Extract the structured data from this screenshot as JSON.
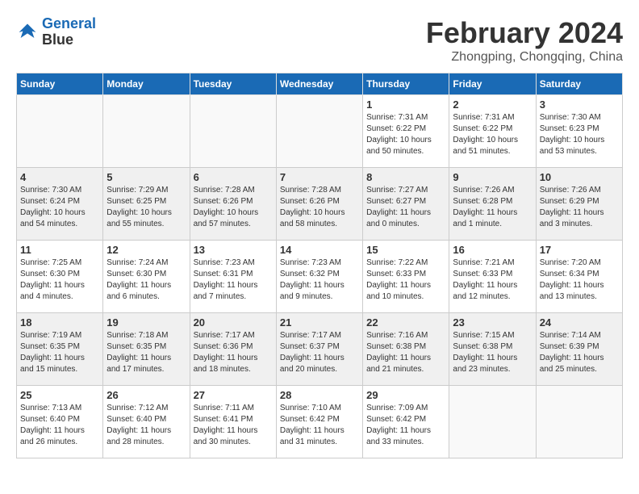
{
  "header": {
    "logo_line1": "General",
    "logo_line2": "Blue",
    "month_year": "February 2024",
    "location": "Zhongping, Chongqing, China"
  },
  "days_of_week": [
    "Sunday",
    "Monday",
    "Tuesday",
    "Wednesday",
    "Thursday",
    "Friday",
    "Saturday"
  ],
  "weeks": [
    {
      "shaded": false,
      "days": [
        {
          "num": "",
          "info": ""
        },
        {
          "num": "",
          "info": ""
        },
        {
          "num": "",
          "info": ""
        },
        {
          "num": "",
          "info": ""
        },
        {
          "num": "1",
          "info": "Sunrise: 7:31 AM\nSunset: 6:22 PM\nDaylight: 10 hours\nand 50 minutes."
        },
        {
          "num": "2",
          "info": "Sunrise: 7:31 AM\nSunset: 6:22 PM\nDaylight: 10 hours\nand 51 minutes."
        },
        {
          "num": "3",
          "info": "Sunrise: 7:30 AM\nSunset: 6:23 PM\nDaylight: 10 hours\nand 53 minutes."
        }
      ]
    },
    {
      "shaded": true,
      "days": [
        {
          "num": "4",
          "info": "Sunrise: 7:30 AM\nSunset: 6:24 PM\nDaylight: 10 hours\nand 54 minutes."
        },
        {
          "num": "5",
          "info": "Sunrise: 7:29 AM\nSunset: 6:25 PM\nDaylight: 10 hours\nand 55 minutes."
        },
        {
          "num": "6",
          "info": "Sunrise: 7:28 AM\nSunset: 6:26 PM\nDaylight: 10 hours\nand 57 minutes."
        },
        {
          "num": "7",
          "info": "Sunrise: 7:28 AM\nSunset: 6:26 PM\nDaylight: 10 hours\nand 58 minutes."
        },
        {
          "num": "8",
          "info": "Sunrise: 7:27 AM\nSunset: 6:27 PM\nDaylight: 11 hours\nand 0 minutes."
        },
        {
          "num": "9",
          "info": "Sunrise: 7:26 AM\nSunset: 6:28 PM\nDaylight: 11 hours\nand 1 minute."
        },
        {
          "num": "10",
          "info": "Sunrise: 7:26 AM\nSunset: 6:29 PM\nDaylight: 11 hours\nand 3 minutes."
        }
      ]
    },
    {
      "shaded": false,
      "days": [
        {
          "num": "11",
          "info": "Sunrise: 7:25 AM\nSunset: 6:30 PM\nDaylight: 11 hours\nand 4 minutes."
        },
        {
          "num": "12",
          "info": "Sunrise: 7:24 AM\nSunset: 6:30 PM\nDaylight: 11 hours\nand 6 minutes."
        },
        {
          "num": "13",
          "info": "Sunrise: 7:23 AM\nSunset: 6:31 PM\nDaylight: 11 hours\nand 7 minutes."
        },
        {
          "num": "14",
          "info": "Sunrise: 7:23 AM\nSunset: 6:32 PM\nDaylight: 11 hours\nand 9 minutes."
        },
        {
          "num": "15",
          "info": "Sunrise: 7:22 AM\nSunset: 6:33 PM\nDaylight: 11 hours\nand 10 minutes."
        },
        {
          "num": "16",
          "info": "Sunrise: 7:21 AM\nSunset: 6:33 PM\nDaylight: 11 hours\nand 12 minutes."
        },
        {
          "num": "17",
          "info": "Sunrise: 7:20 AM\nSunset: 6:34 PM\nDaylight: 11 hours\nand 13 minutes."
        }
      ]
    },
    {
      "shaded": true,
      "days": [
        {
          "num": "18",
          "info": "Sunrise: 7:19 AM\nSunset: 6:35 PM\nDaylight: 11 hours\nand 15 minutes."
        },
        {
          "num": "19",
          "info": "Sunrise: 7:18 AM\nSunset: 6:35 PM\nDaylight: 11 hours\nand 17 minutes."
        },
        {
          "num": "20",
          "info": "Sunrise: 7:17 AM\nSunset: 6:36 PM\nDaylight: 11 hours\nand 18 minutes."
        },
        {
          "num": "21",
          "info": "Sunrise: 7:17 AM\nSunset: 6:37 PM\nDaylight: 11 hours\nand 20 minutes."
        },
        {
          "num": "22",
          "info": "Sunrise: 7:16 AM\nSunset: 6:38 PM\nDaylight: 11 hours\nand 21 minutes."
        },
        {
          "num": "23",
          "info": "Sunrise: 7:15 AM\nSunset: 6:38 PM\nDaylight: 11 hours\nand 23 minutes."
        },
        {
          "num": "24",
          "info": "Sunrise: 7:14 AM\nSunset: 6:39 PM\nDaylight: 11 hours\nand 25 minutes."
        }
      ]
    },
    {
      "shaded": false,
      "days": [
        {
          "num": "25",
          "info": "Sunrise: 7:13 AM\nSunset: 6:40 PM\nDaylight: 11 hours\nand 26 minutes."
        },
        {
          "num": "26",
          "info": "Sunrise: 7:12 AM\nSunset: 6:40 PM\nDaylight: 11 hours\nand 28 minutes."
        },
        {
          "num": "27",
          "info": "Sunrise: 7:11 AM\nSunset: 6:41 PM\nDaylight: 11 hours\nand 30 minutes."
        },
        {
          "num": "28",
          "info": "Sunrise: 7:10 AM\nSunset: 6:42 PM\nDaylight: 11 hours\nand 31 minutes."
        },
        {
          "num": "29",
          "info": "Sunrise: 7:09 AM\nSunset: 6:42 PM\nDaylight: 11 hours\nand 33 minutes."
        },
        {
          "num": "",
          "info": ""
        },
        {
          "num": "",
          "info": ""
        }
      ]
    }
  ]
}
